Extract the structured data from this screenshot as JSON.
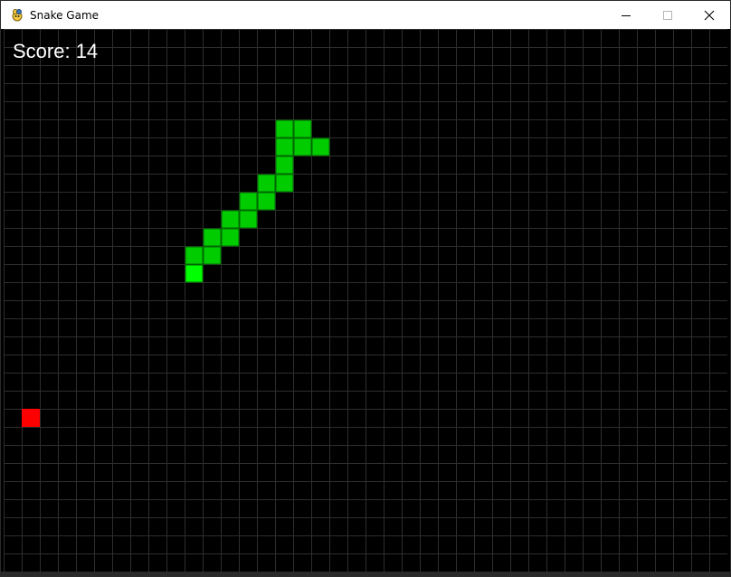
{
  "window": {
    "title": "Snake Game",
    "icon": "pygame-snake-icon",
    "controls": [
      "minimize",
      "maximize",
      "close"
    ]
  },
  "game": {
    "score_text": "Score: 14",
    "grid": {
      "cols": 40,
      "rows": 30,
      "line_color": "#2e2e2e",
      "background": "#000000"
    },
    "snake": {
      "head_color": "#00ff00",
      "body_color": "#00cc00",
      "segment_border": "#006600",
      "head": [
        10,
        13
      ],
      "body": [
        [
          10,
          12
        ],
        [
          11,
          12
        ],
        [
          11,
          11
        ],
        [
          12,
          11
        ],
        [
          12,
          10
        ],
        [
          13,
          10
        ],
        [
          13,
          9
        ],
        [
          14,
          9
        ],
        [
          14,
          8
        ],
        [
          15,
          8
        ],
        [
          15,
          7
        ],
        [
          15,
          6
        ],
        [
          15,
          5
        ],
        [
          16,
          5
        ],
        [
          16,
          6
        ],
        [
          17,
          6
        ]
      ]
    },
    "food": {
      "color": "#ff0000",
      "cell": [
        1,
        21
      ]
    }
  }
}
